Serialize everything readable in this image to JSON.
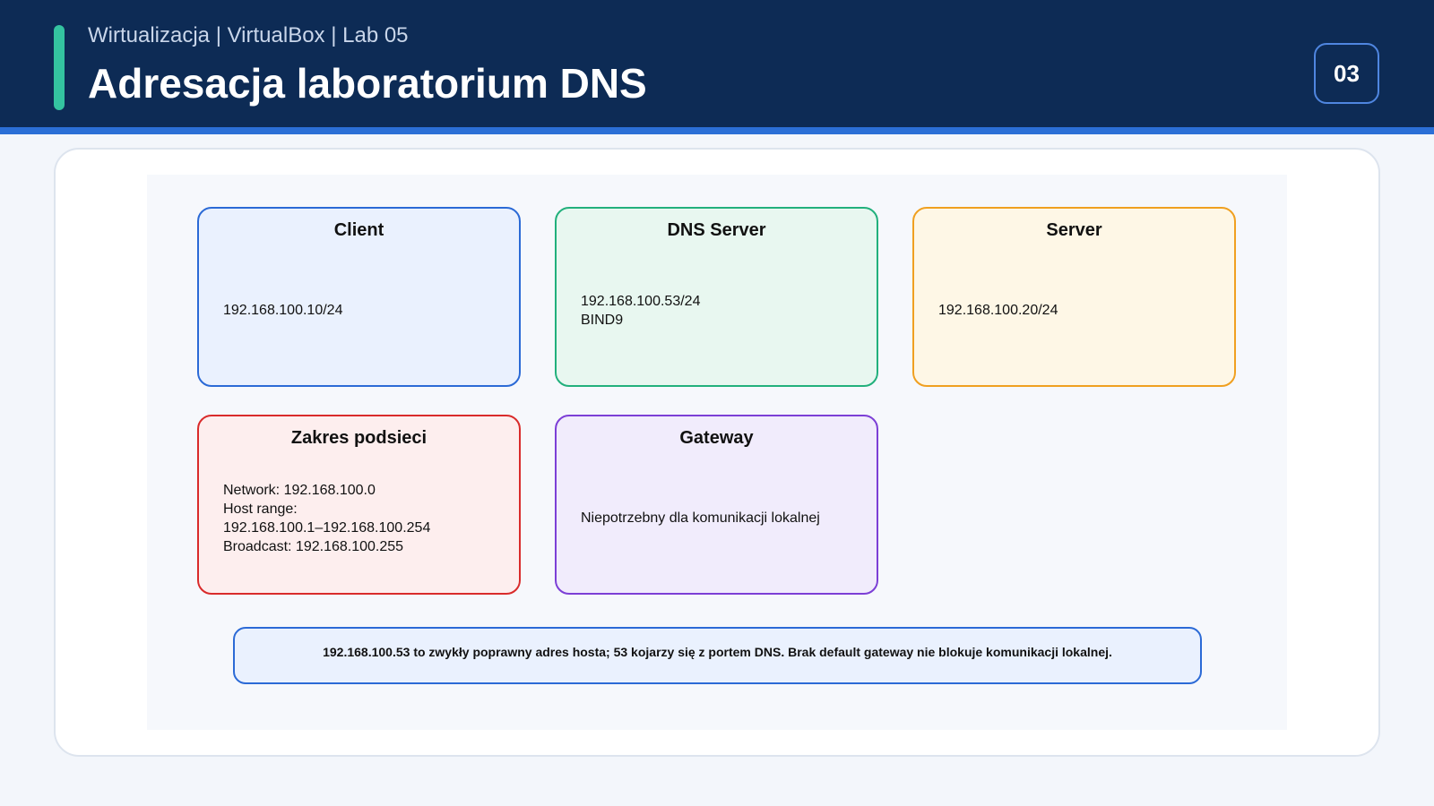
{
  "header": {
    "subtitle": "Wirtualizacja | VirtualBox | Lab 05",
    "title": "Adresacja laboratorium DNS",
    "slide_number": "03"
  },
  "colors": {
    "header_bg": "#0d2b55",
    "accent": "#34c3a0",
    "client": "#2b6ad6",
    "dns_server": "#22b07c",
    "server": "#f0a020",
    "subnet": "#d92b2b",
    "gateway": "#7c3fd6"
  },
  "nodes": {
    "client": {
      "title": "Client",
      "lines": [
        "192.168.100.10/24"
      ]
    },
    "dns_server": {
      "title": "DNS Server",
      "lines": [
        "192.168.100.53/24",
        "BIND9"
      ]
    },
    "server": {
      "title": "Server",
      "lines": [
        "192.168.100.20/24"
      ]
    },
    "subnet": {
      "title": "Zakres podsieci",
      "lines": [
        "Network: 192.168.100.0",
        "Host range:",
        "192.168.100.1–192.168.100.254",
        "Broadcast: 192.168.100.255"
      ]
    },
    "gateway": {
      "title": "Gateway",
      "lines": [
        "Niepotrzebny dla komunikacji lokalnej"
      ]
    }
  },
  "note": "192.168.100.53 to zwykły poprawny adres hosta; 53 kojarzy się z portem DNS. Brak default gateway nie blokuje komunikacji lokalnej."
}
